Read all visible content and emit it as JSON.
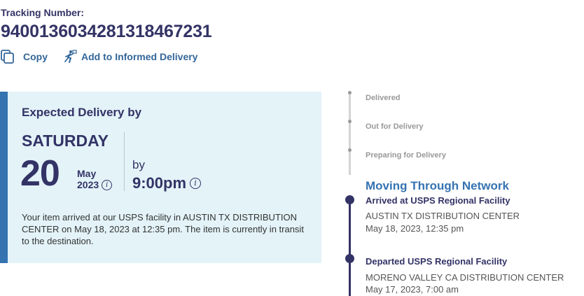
{
  "tracking": {
    "label": "Tracking Number:",
    "number": "9400136034281318467231"
  },
  "actions": {
    "copy_label": "Copy",
    "informed_label": "Add to Informed Delivery"
  },
  "expected": {
    "title": "Expected Delivery by",
    "day_name": "SATURDAY",
    "day_number": "20",
    "month": "May",
    "year": "2023",
    "by_label": "by",
    "time": "9:00pm",
    "status_text": "Your item arrived at our USPS facility in AUSTIN TX DISTRIBUTION CENTER on May 18, 2023 at 12:35 pm. The item is currently in transit to the destination."
  },
  "timeline": {
    "steps": [
      "Delivered",
      "Out for Delivery",
      "Preparing for Delivery"
    ],
    "current_heading": "Moving Through Network",
    "events": [
      {
        "title": "Arrived at USPS Regional Facility",
        "location": "AUSTIN TX DISTRIBUTION CENTER",
        "date": "May 18, 2023, 12:35 pm"
      },
      {
        "title": "Departed USPS Regional Facility",
        "location": "MORENO VALLEY CA DISTRIBUTION CENTER",
        "date": "May 17, 2023, 7:00 am"
      }
    ]
  },
  "colors": {
    "navy": "#333366",
    "link_blue": "#336699",
    "accent_blue": "#3573b1",
    "panel_bg": "#e3f3f8",
    "muted_gray": "#999999"
  },
  "icons": {
    "copy": "copy-icon",
    "informed": "informed-delivery-icon",
    "info": "info-icon"
  }
}
